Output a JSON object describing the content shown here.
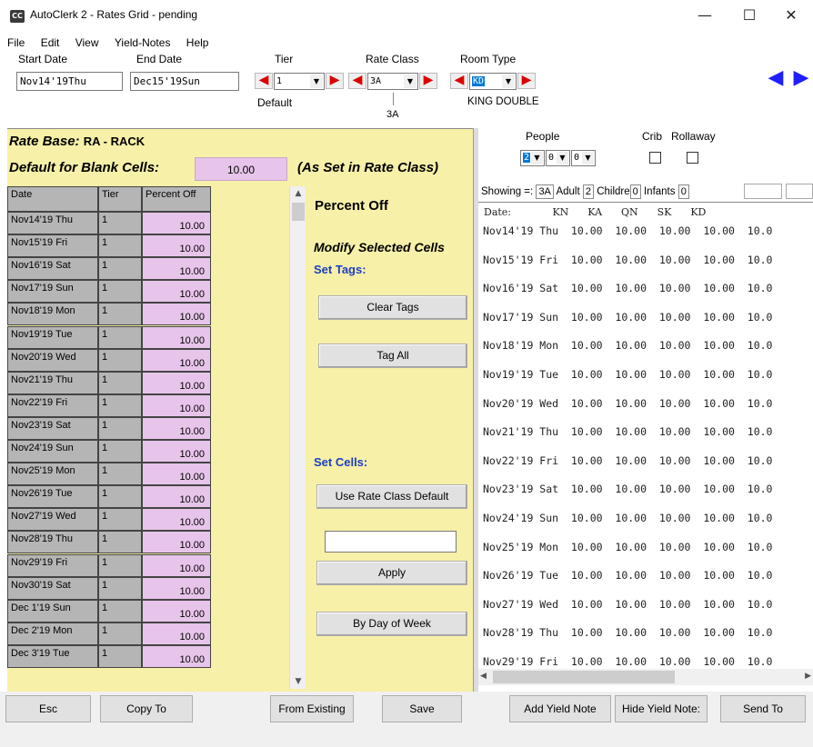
{
  "window": {
    "title": "AutoClerk 2 - Rates Grid - pending",
    "icon_text": "CC",
    "minimize": "—",
    "maximize": "☐",
    "close": "✕"
  },
  "menu": [
    "File",
    "Edit",
    "View",
    "Yield-Notes",
    "Help"
  ],
  "toolbar": {
    "start_date_label": "Start Date",
    "start_date_value": "Nov14'19Thu",
    "end_date_label": "End Date",
    "end_date_value": "Dec15'19Sun",
    "tier_label": "Tier",
    "tier_value": "1",
    "tier_caption": "Default",
    "rate_class_label": "Rate Class",
    "rate_class_value": "3A",
    "rate_class_caption": "3A",
    "room_type_label": "Room Type",
    "room_type_value": "KD",
    "room_type_caption": "KING DOUBLE"
  },
  "left": {
    "rate_base_label": "Rate Base:",
    "rate_base_value": "RA - RACK",
    "default_blank_label": "Default for Blank Cells:",
    "default_blank_value": "10.00",
    "as_set_label": "(As Set in Rate Class)",
    "columns": [
      "Date",
      "Tier",
      "Percent Off"
    ],
    "rows": [
      {
        "date": "Nov14'19 Thu",
        "tier": "1",
        "pct": "10.00"
      },
      {
        "date": "Nov15'19 Fri",
        "tier": "1",
        "pct": "10.00"
      },
      {
        "date": "Nov16'19 Sat",
        "tier": "1",
        "pct": "10.00"
      },
      {
        "date": "Nov17'19 Sun",
        "tier": "1",
        "pct": "10.00"
      },
      {
        "date": "Nov18'19 Mon",
        "tier": "1",
        "pct": "10.00"
      },
      {
        "date": "Nov19'19 Tue",
        "tier": "1",
        "pct": "10.00"
      },
      {
        "date": "Nov20'19 Wed",
        "tier": "1",
        "pct": "10.00"
      },
      {
        "date": "Nov21'19 Thu",
        "tier": "1",
        "pct": "10.00"
      },
      {
        "date": "Nov22'19 Fri",
        "tier": "1",
        "pct": "10.00"
      },
      {
        "date": "Nov23'19 Sat",
        "tier": "1",
        "pct": "10.00"
      },
      {
        "date": "Nov24'19 Sun",
        "tier": "1",
        "pct": "10.00"
      },
      {
        "date": "Nov25'19 Mon",
        "tier": "1",
        "pct": "10.00"
      },
      {
        "date": "Nov26'19 Tue",
        "tier": "1",
        "pct": "10.00"
      },
      {
        "date": "Nov27'19 Wed",
        "tier": "1",
        "pct": "10.00"
      },
      {
        "date": "Nov28'19 Thu",
        "tier": "1",
        "pct": "10.00"
      },
      {
        "date": "Nov29'19 Fri",
        "tier": "1",
        "pct": "10.00"
      },
      {
        "date": "Nov30'19 Sat",
        "tier": "1",
        "pct": "10.00"
      },
      {
        "date": "Dec 1'19 Sun",
        "tier": "1",
        "pct": "10.00"
      },
      {
        "date": "Dec 2'19 Mon",
        "tier": "1",
        "pct": "10.00"
      },
      {
        "date": "Dec 3'19 Tue",
        "tier": "1",
        "pct": "10.00"
      }
    ]
  },
  "side": {
    "title": "Percent Off",
    "modify": "Modify Selected Cells",
    "set_tags": "Set Tags:",
    "clear_tags": "Clear Tags",
    "tag_all": "Tag All",
    "set_cells": "Set Cells:",
    "use_default": "Use Rate Class Default",
    "set_value": "",
    "apply": "Apply",
    "by_dow": "By Day of Week"
  },
  "right": {
    "people_label": "People",
    "crib_label": "Crib",
    "rollaway_label": "Rollaway",
    "people_values": [
      "2",
      "0",
      "0"
    ],
    "showing_label": "Showing =:",
    "showing_value": "3A",
    "adult_label": "Adult",
    "adult_value": "2",
    "children_label": "Childre",
    "children_value": "0",
    "infants_label": "Infants",
    "infants_value": "0",
    "header": "Date:             KN      KA      QN      SK      KD",
    "rows": [
      "Nov14'19 Thu  10.00  10.00  10.00  10.00  10.0",
      "Nov15'19 Fri  10.00  10.00  10.00  10.00  10.0",
      "Nov16'19 Sat  10.00  10.00  10.00  10.00  10.0",
      "Nov17'19 Sun  10.00  10.00  10.00  10.00  10.0",
      "Nov18'19 Mon  10.00  10.00  10.00  10.00  10.0",
      "Nov19'19 Tue  10.00  10.00  10.00  10.00  10.0",
      "Nov20'19 Wed  10.00  10.00  10.00  10.00  10.0",
      "Nov21'19 Thu  10.00  10.00  10.00  10.00  10.0",
      "Nov22'19 Fri  10.00  10.00  10.00  10.00  10.0",
      "Nov23'19 Sat  10.00  10.00  10.00  10.00  10.0",
      "Nov24'19 Sun  10.00  10.00  10.00  10.00  10.0",
      "Nov25'19 Mon  10.00  10.00  10.00  10.00  10.0",
      "Nov26'19 Tue  10.00  10.00  10.00  10.00  10.0",
      "Nov27'19 Wed  10.00  10.00  10.00  10.00  10.0",
      "Nov28'19 Thu  10.00  10.00  10.00  10.00  10.0",
      "Nov29'19 Fri  10.00  10.00  10.00  10.00  10.0"
    ]
  },
  "bottom": {
    "esc": "Esc",
    "copy_to": "Copy To",
    "from_existing": "From Existing",
    "save": "Save",
    "add_yield": "Add Yield Note",
    "hide_yield": "Hide Yield Note:",
    "send_to": "Send To"
  },
  "colors": {
    "panel_yellow": "#f7f0a8",
    "cell_pink": "#e7c4ea",
    "cell_gray": "#b5b5b5",
    "link_blue": "#1b3fc4",
    "arrow_red": "#dd0000",
    "nav_blue": "#1f1fff"
  }
}
